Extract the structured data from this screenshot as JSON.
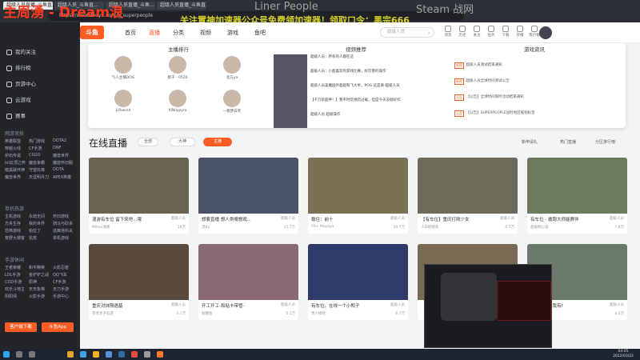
{
  "browser": {
    "tabs": [
      "超级人员直播_斗鱼直…",
      "超级人员_斗鱼直…",
      "超级人员直播_斗鱼…",
      "Liner",
      "超级人员直播_斗鱼直…",
      "Steam 战网"
    ],
    "url": "https://www.douyu.com/g_superpeople"
  },
  "stream_overlay": {
    "host_name": "主周湧",
    "dash": " - ",
    "host_name_en": "Dream浪",
    "promo_text": "关注置神加速器公众号免费领加速器！领取口令：黑宗666",
    "bg_words": [
      "Liner People",
      "Steam 战网"
    ]
  },
  "sidebar": {
    "top_items": [
      "我的关注",
      "排行榜",
      "页游中心",
      "云游戏",
      "赛事"
    ],
    "sections": [
      {
        "title": "网游竞技",
        "items": [
          "英雄联盟",
          "热门游戏",
          "DOTA2",
          "穿越火线",
          "CF手游",
          "DNF",
          "炉石传说",
          "CSGO",
          "魔兽世界",
          "lol云顶之弈",
          "魔兽争霸",
          "魔兽怀旧服",
          "暗黑破坏神",
          "守望先锋",
          "DOTA",
          "魔兽世界",
          "天涯明月刀",
          "APEX英雄"
        ]
      },
      {
        "title": "单机热游",
        "items": [
          "主机游戏",
          "永劫无间",
          "怀旧游戏",
          "方舟生存",
          "我的世界",
          "骑马与砍杀",
          "恐怖游戏",
          "帕拉丁",
          "逃离塔科夫",
          "荒野大镖客",
          "饥荒",
          "单机游戏"
        ]
      },
      {
        "title": "手游休闲",
        "items": [
          "王者荣耀",
          "和平精英",
          "火影忍者",
          "LOL手游",
          "金铲铲之战",
          "QQ飞车",
          "COD手游",
          "原神",
          "CF手游",
          "欢乐斗地主",
          "天天象棋",
          "天刀手游",
          "阴阳师",
          "火影手游",
          "手游中心"
        ]
      }
    ],
    "buttons": {
      "client": "客户端下载",
      "app": "斗鱼App"
    }
  },
  "header": {
    "logo": "斗鱼",
    "nav": [
      "首页",
      "直播",
      "分类",
      "视频",
      "游戏",
      "鱼吧"
    ],
    "active_nav": "直播",
    "search_placeholder": "超级人员",
    "icons": [
      {
        "name": "message",
        "label": "消息"
      },
      {
        "name": "history",
        "label": "历史"
      },
      {
        "name": "follow",
        "label": "关注"
      },
      {
        "name": "task",
        "label": "任务"
      },
      {
        "name": "download",
        "label": "下载"
      },
      {
        "name": "broadcast",
        "label": "开播"
      },
      {
        "name": "client",
        "label": "客户端"
      }
    ]
  },
  "dropdown": {
    "anchors_title": "主播排行",
    "videos_title": "视频推荐",
    "news_title": "游戏资讯",
    "anchors": [
      {
        "name": "气人主播DOG"
      },
      {
        "name": "橙子 - 0520"
      },
      {
        "name": "北方ya"
      },
      {
        "name": "Lifewind"
      },
      {
        "name": "XiNilypyro"
      },
      {
        "name": "一颗梦白笑"
      }
    ],
    "videos": [
      "超级人员：所有的人都在这",
      "超级人员：小超喜欢的游戏比赛，好厉害的操作",
      "超级人员美魔国外超越和飞大举，POG 这是真·超级人员",
      "【千刀斩超神！】我平时玩弹药过载，但是今天没辦好作",
      "超级人员 超级操作"
    ],
    "news": [
      {
        "tag": "新闻",
        "text": "超级人员测试结束通知"
      },
      {
        "tag": "新闻",
        "text": "超级人员全球时间测试公告"
      },
      {
        "tag": "公告",
        "text": "【公告】全球时间限时活动结束通知"
      },
      {
        "tag": "公告",
        "text": "【公告】SUPERPEOPLE战时地区规划标签"
      }
    ]
  },
  "live_section": {
    "title": "在线直播",
    "filters": [
      "全部",
      "大神",
      "主播"
    ],
    "active_filter": "主播",
    "links": [
      "新申请礼",
      "热门直播",
      "分区排行榜"
    ]
  },
  "cards": [
    {
      "title": "漫游有车位 留下来吧...哦",
      "category": "超级人员",
      "host": "Mitsui清寒",
      "popularity": "16万"
    },
    {
      "title": "想要直播 想人类嘴想观...",
      "category": "超级人员",
      "host": "漠Bu",
      "popularity": "15.7万"
    },
    {
      "title": "稳住：前十",
      "category": "超级人员",
      "host": "5S+ Meyaya",
      "popularity": "10.7万"
    },
    {
      "title": "【有车位】重庆打败少女",
      "category": "超级人员",
      "host": "小白鹤明先",
      "popularity": "6.5万"
    },
    {
      "title": "有车位 - 敢跑大师能赛伴",
      "category": "超级人员",
      "host": "超级明心道",
      "popularity": "7.8万"
    },
    {
      "title": "重庆对抹限遇基",
      "category": "超级人员",
      "host": "苍老老子仙游",
      "popularity": "3.1万"
    },
    {
      "title": "开工开工-和粘卡带管-",
      "category": "超级人员",
      "host": "粘糖鱼",
      "popularity": "5.1万"
    },
    {
      "title": "有车位，在线一个小鸭子",
      "category": "超级人员",
      "host": "贵小摸哈",
      "popularity": "6.7万"
    },
    {
      "title": "",
      "category": "",
      "host": "",
      "popularity": ""
    },
    {
      "title": "有我我我我我有!",
      "category": "超级人员",
      "host": "花茶一盘",
      "popularity": "4.2万"
    }
  ],
  "taskbar": {
    "time": "04:05",
    "date": "2022/03/22"
  }
}
